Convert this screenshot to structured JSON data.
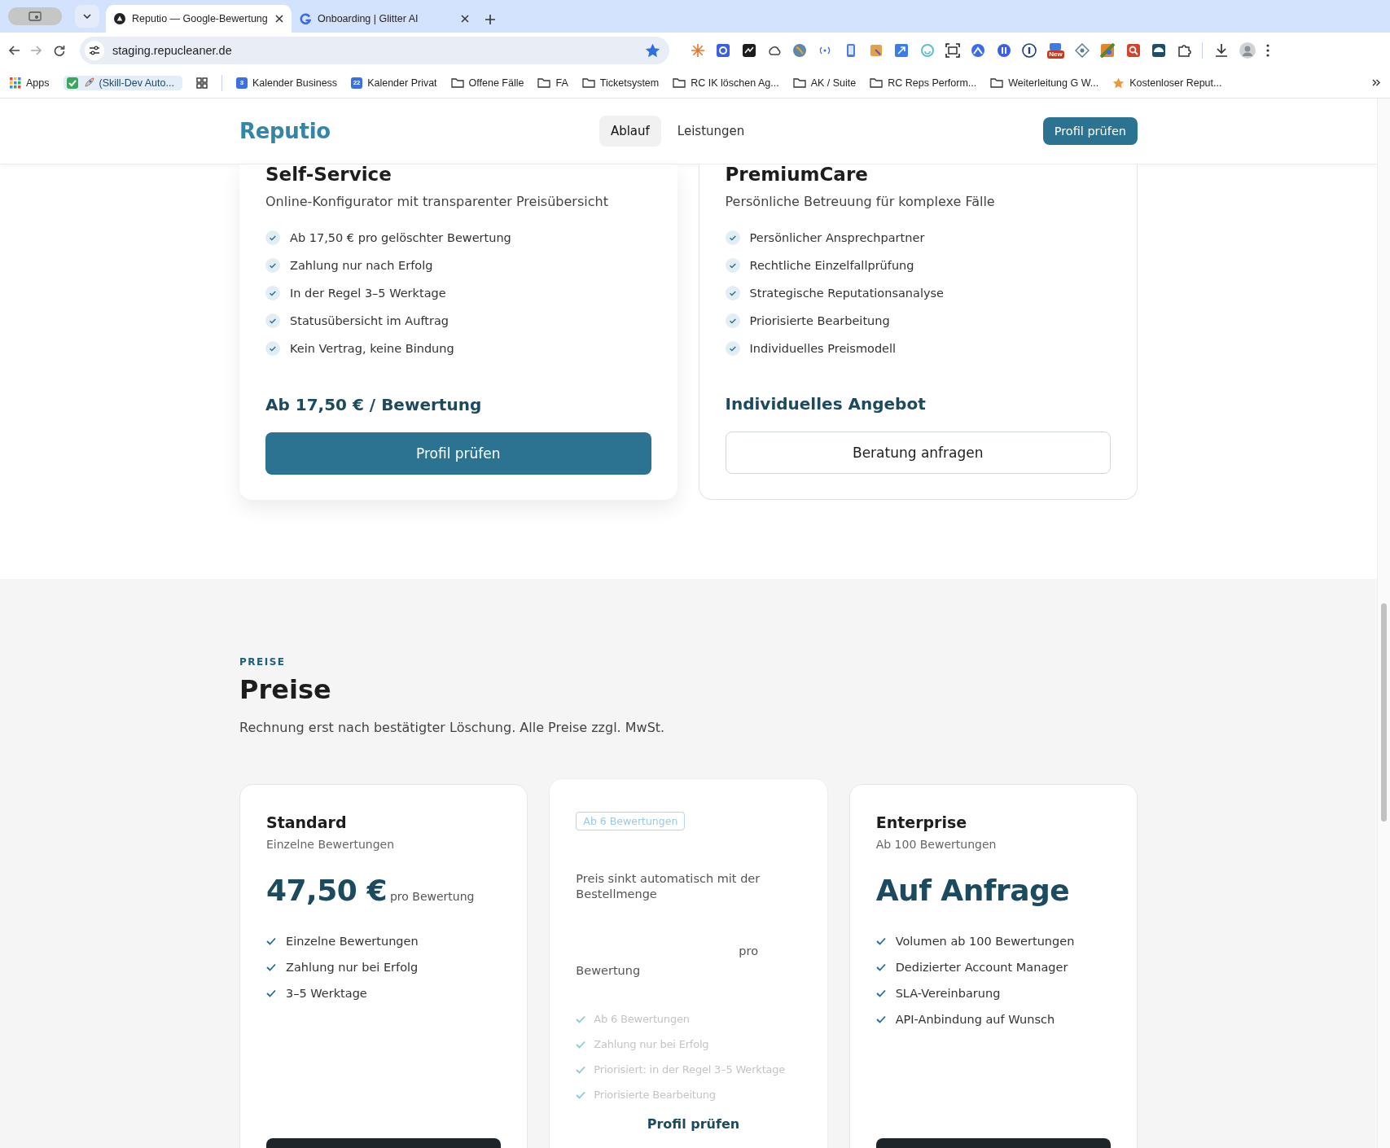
{
  "browser": {
    "tabs": [
      {
        "title": "Reputio — Google-Bewertung",
        "selected": true
      },
      {
        "title": "Onboarding | Glitter AI",
        "selected": false
      }
    ],
    "address": "staging.repucleaner.de",
    "bookmarked": true,
    "extension_badge": "New",
    "bookmarks": [
      {
        "kind": "apps",
        "label": "Apps"
      },
      {
        "kind": "highlight",
        "label": "(Skill-Dev Auto..."
      },
      {
        "kind": "grid"
      },
      {
        "kind": "calendar",
        "badge": "3",
        "label": "Kalender Business"
      },
      {
        "kind": "calendar",
        "badge": "22",
        "label": "Kalender Privat"
      },
      {
        "kind": "folder",
        "label": "Offene Fälle"
      },
      {
        "kind": "folder",
        "label": "FA"
      },
      {
        "kind": "folder",
        "label": "Ticketsystem"
      },
      {
        "kind": "folder",
        "label": "RC IK löschen Ag..."
      },
      {
        "kind": "folder",
        "label": "AK / Suite"
      },
      {
        "kind": "folder",
        "label": "RC Reps Perform..."
      },
      {
        "kind": "folder",
        "label": "Weiterleitung G W..."
      },
      {
        "kind": "star",
        "label": "Kostenloser Reput..."
      }
    ]
  },
  "site": {
    "logo": "Reputio",
    "nav": [
      {
        "label": "Ablauf",
        "selected": true
      },
      {
        "label": "Leistungen",
        "selected": false
      }
    ],
    "cta": "Profil prüfen"
  },
  "service_cards": [
    {
      "kind": "primary",
      "title": "Self-Service",
      "subtitle": "Online-Konfigurator mit transparenter Preisübersicht",
      "features": [
        "Ab 17,50 € pro gelöschter Bewertung",
        "Zahlung nur nach Erfolg",
        "In der Regel 3–5 Werktage",
        "Statusübersicht im Auftrag",
        "Kein Vertrag, keine Bindung"
      ],
      "price": "Ab 17,50 € / Bewertung",
      "button": "Profil prüfen"
    },
    {
      "kind": "outline",
      "title": "PremiumCare",
      "subtitle": "Persönliche Betreuung für komplexe Fälle",
      "features": [
        "Persönlicher Ansprechpartner",
        "Rechtliche Einzelfallprüfung",
        "Strategische Reputationsanalyse",
        "Priorisierte Bearbeitung",
        "Individuelles Preismodell"
      ],
      "price": "Individuelles Angebot",
      "button": "Beratung anfragen"
    }
  ],
  "pricing": {
    "eyebrow": "PREISE",
    "title": "Preise",
    "subtitle": "Rechnung erst nach bestätigter Löschung. Alle Preise zzgl. MwSt.",
    "plans": [
      {
        "kind": "standard",
        "name": "Standard",
        "subtitle": "Einzelne Bewertungen",
        "price": "47,50 €",
        "unit": "pro Bewertung",
        "features": [
          "Einzelne Bewertungen",
          "Zahlung nur bei Erfolg",
          "3–5 Werktage"
        ]
      },
      {
        "kind": "faded",
        "badge": "Ab 6 Bewertungen",
        "description": "Preis sinkt automatisch mit der Bestellmenge",
        "unit": "pro Bewertung",
        "features": [
          "Ab 6 Bewertungen",
          "Zahlung nur bei Erfolg",
          "Priorisiert: in der Regel 3–5 Werktage",
          "Priorisierte Bearbeitung"
        ],
        "button": "Profil prüfen"
      },
      {
        "kind": "standard",
        "name": "Enterprise",
        "subtitle": "Ab 100 Bewertungen",
        "price": "Auf Anfrage",
        "features": [
          "Volumen ab 100 Bewertungen",
          "Dedizierter Account Manager",
          "SLA-Vereinbarung",
          "API-Anbindung auf Wunsch"
        ]
      }
    ]
  }
}
